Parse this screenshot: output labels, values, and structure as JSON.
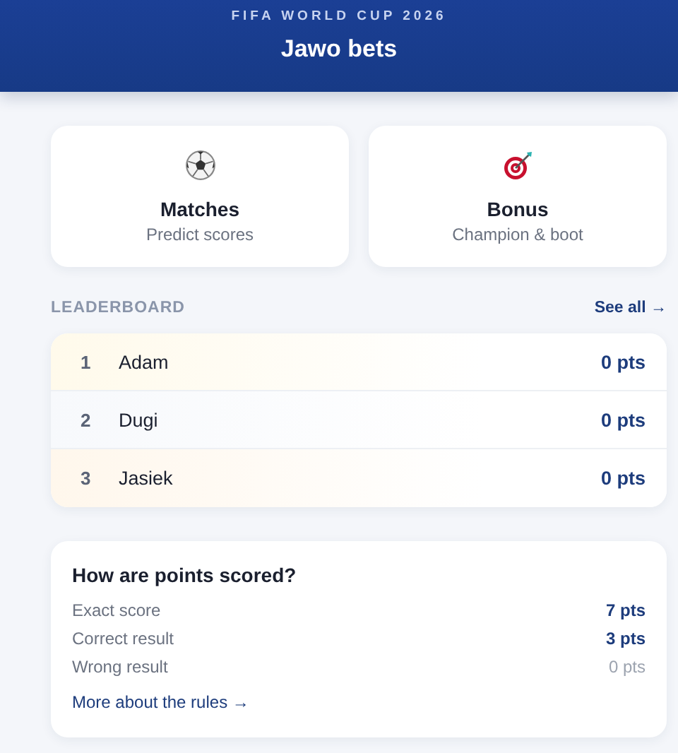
{
  "header": {
    "subtitle": "FIFA WORLD CUP 2026",
    "title": "Jawo bets"
  },
  "tiles": [
    {
      "kind": "ball",
      "title": "Matches",
      "subtitle": "Predict scores"
    },
    {
      "kind": "target",
      "title": "Bonus",
      "subtitle": "Champion & boot"
    }
  ],
  "leaderboard": {
    "heading": "LEADERBOARD",
    "link": "See all →",
    "rows": [
      {
        "rank": "1",
        "name": "Adam",
        "points": "0 pts",
        "color": "#fffaeb"
      },
      {
        "rank": "2",
        "name": "Dugi",
        "points": "0 pts",
        "color": "#f7f9fc"
      },
      {
        "rank": "3",
        "name": "Jasiek",
        "points": "0 pts",
        "color": "#fff7ec"
      }
    ]
  },
  "rules": {
    "title": "How are points scored?",
    "items": [
      {
        "label": "Exact score",
        "points": "7 pts",
        "muted": false
      },
      {
        "label": "Correct result",
        "points": "3 pts",
        "muted": false
      },
      {
        "label": "Wrong result",
        "points": "0 pts",
        "muted": true
      }
    ],
    "link": "More about the rules →"
  }
}
